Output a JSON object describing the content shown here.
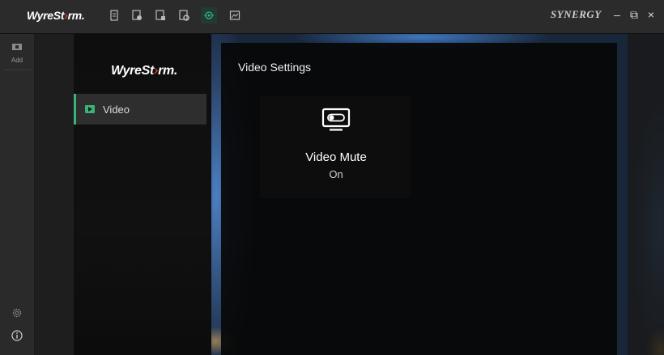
{
  "app": {
    "brand": "WyreStorm",
    "brand_part1": "WyreSt",
    "brand_part2": "rm.",
    "product_logo": "SYNERGY",
    "accent": "#3ab37a"
  },
  "titlebar": {
    "tool_icons": [
      "document-icon",
      "device-a-icon",
      "device-b-icon",
      "device-c-icon",
      "camera-settings-icon",
      "image-icon"
    ],
    "active_tool": "camera-settings-icon",
    "minimize": "–",
    "restore": "⧉",
    "close": "×"
  },
  "rail": {
    "add_label": "Add",
    "icons": [
      "add-device-icon",
      "gear-icon",
      "info-icon"
    ]
  },
  "sidebar": {
    "items": [
      {
        "label": "Video",
        "icon": "video-icon",
        "selected": true
      }
    ]
  },
  "main": {
    "title": "Video Settings",
    "tile": {
      "icon": "video-mute-icon",
      "label": "Video Mute",
      "state": "On"
    }
  }
}
